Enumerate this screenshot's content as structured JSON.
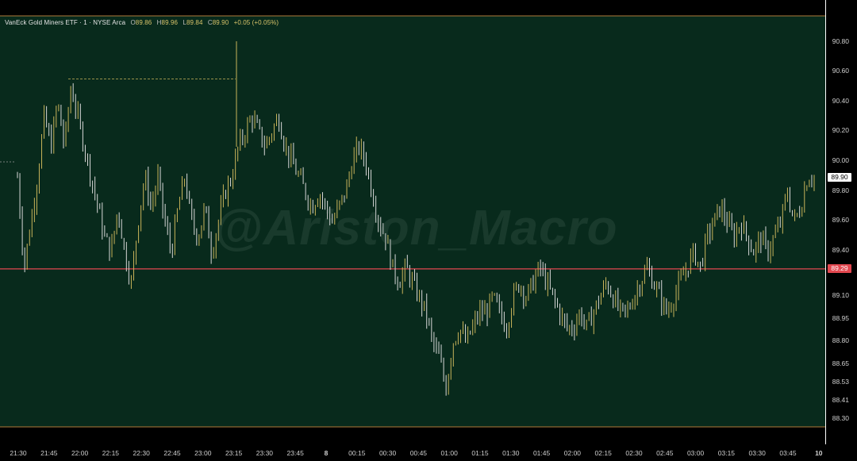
{
  "legend": {
    "symbol": "VanEck Gold Miners ETF · 1 · NYSE Arca",
    "open_label": "O",
    "open": "89.86",
    "high_label": "H",
    "high": "89.96",
    "low_label": "L",
    "low": "89.84",
    "close_label": "C",
    "close": "89.90",
    "change": "+0.05 (+0.05%)"
  },
  "watermark": "@Ariston_Macro",
  "colors": {
    "background": "#082a1c",
    "up_bar": "#c9b45a",
    "down_bar": "#d8d8d8",
    "reference_line": "#e2474f",
    "session_border": "#b07a3a"
  },
  "price_axis": {
    "last_price": "89.90",
    "reference_price": "89.29"
  },
  "chart_data": {
    "type": "ohlc",
    "title": "VanEck Gold Miners ETF · 1 · NYSE Arca",
    "x_ticks": [
      "21:30",
      "21:45",
      "22:00",
      "22:15",
      "22:30",
      "22:45",
      "23:00",
      "23:15",
      "23:30",
      "23:45",
      "8",
      "00:15",
      "00:30",
      "00:45",
      "01:00",
      "01:15",
      "01:30",
      "01:45",
      "02:00",
      "02:15",
      "02:30",
      "02:45",
      "03:00",
      "03:15",
      "03:30",
      "03:45",
      "10"
    ],
    "y_ticks": [
      "90.80",
      "90.60",
      "90.40",
      "90.20",
      "90.00",
      "89.80",
      "89.60",
      "89.40",
      "89.25",
      "89.10",
      "88.95",
      "88.80",
      "88.65",
      "88.53",
      "88.41",
      "88.30"
    ],
    "ylim": [
      88.3,
      90.8
    ],
    "reference_line": 89.29,
    "last_price": 89.9,
    "dashed_level": 90.55,
    "path_time_price": [
      [
        "21:30",
        89.9
      ],
      [
        "21:33",
        89.3
      ],
      [
        "21:36",
        89.6
      ],
      [
        "21:39",
        89.9
      ],
      [
        "21:42",
        90.3
      ],
      [
        "21:45",
        90.1
      ],
      [
        "21:48",
        90.4
      ],
      [
        "21:51",
        90.1
      ],
      [
        "21:54",
        90.5
      ],
      [
        "21:57",
        90.3
      ],
      [
        "22:00",
        90.1
      ],
      [
        "22:03",
        89.9
      ],
      [
        "22:06",
        89.7
      ],
      [
        "22:09",
        89.5
      ],
      [
        "22:12",
        89.4
      ],
      [
        "22:15",
        89.7
      ],
      [
        "22:18",
        89.4
      ],
      [
        "22:21",
        89.2
      ],
      [
        "22:24",
        89.6
      ],
      [
        "22:27",
        89.9
      ],
      [
        "22:30",
        89.7
      ],
      [
        "22:33",
        89.9
      ],
      [
        "22:36",
        89.6
      ],
      [
        "22:39",
        89.4
      ],
      [
        "22:42",
        89.7
      ],
      [
        "22:45",
        89.9
      ],
      [
        "22:48",
        89.6
      ],
      [
        "22:51",
        89.5
      ],
      [
        "22:54",
        89.7
      ],
      [
        "22:57",
        89.4
      ],
      [
        "23:00",
        89.6
      ],
      [
        "23:03",
        89.8
      ],
      [
        "23:06",
        89.9
      ],
      [
        "23:09",
        90.1
      ],
      [
        "23:12",
        90.2
      ],
      [
        "23:15",
        90.3
      ],
      [
        "23:18",
        90.2
      ],
      [
        "23:21",
        90.1
      ],
      [
        "23:24",
        90.2
      ],
      [
        "23:27",
        90.3
      ],
      [
        "23:30",
        90.1
      ],
      [
        "23:33",
        90.0
      ],
      [
        "23:36",
        89.9
      ],
      [
        "23:39",
        89.8
      ],
      [
        "23:42",
        89.7
      ],
      [
        "23:45",
        89.8
      ],
      [
        "23:48",
        89.7
      ],
      [
        "23:51",
        89.6
      ],
      [
        "23:54",
        89.7
      ],
      [
        "23:57",
        89.8
      ],
      [
        "00:00",
        90.0
      ],
      [
        "00:03",
        90.1
      ],
      [
        "00:06",
        90.0
      ],
      [
        "00:09",
        89.8
      ],
      [
        "00:12",
        89.6
      ],
      [
        "00:15",
        89.5
      ],
      [
        "00:18",
        89.3
      ],
      [
        "00:21",
        89.2
      ],
      [
        "00:24",
        89.3
      ],
      [
        "00:27",
        89.2
      ],
      [
        "00:30",
        89.1
      ],
      [
        "00:33",
        89.0
      ],
      [
        "00:36",
        88.8
      ],
      [
        "00:39",
        88.7
      ],
      [
        "00:42",
        88.5
      ],
      [
        "00:45",
        88.8
      ],
      [
        "00:48",
        88.9
      ],
      [
        "00:51",
        88.8
      ],
      [
        "00:54",
        88.9
      ],
      [
        "00:57",
        89.0
      ],
      [
        "01:00",
        89.0
      ],
      [
        "01:03",
        89.1
      ],
      [
        "01:06",
        89.0
      ],
      [
        "01:09",
        88.9
      ],
      [
        "01:12",
        89.1
      ],
      [
        "01:15",
        89.2
      ],
      [
        "01:18",
        89.1
      ],
      [
        "01:21",
        89.2
      ],
      [
        "01:24",
        89.3
      ],
      [
        "01:27",
        89.2
      ],
      [
        "01:30",
        89.1
      ],
      [
        "01:33",
        89.0
      ],
      [
        "01:36",
        88.9
      ],
      [
        "01:39",
        88.9
      ],
      [
        "01:42",
        89.0
      ],
      [
        "01:45",
        88.9
      ],
      [
        "01:48",
        89.0
      ],
      [
        "01:51",
        89.1
      ],
      [
        "01:54",
        89.2
      ],
      [
        "01:57",
        89.1
      ],
      [
        "02:00",
        89.0
      ],
      [
        "02:03",
        89.0
      ],
      [
        "02:06",
        89.1
      ],
      [
        "02:09",
        89.2
      ],
      [
        "02:12",
        89.3
      ],
      [
        "02:15",
        89.2
      ],
      [
        "02:18",
        89.1
      ],
      [
        "02:21",
        89.0
      ],
      [
        "02:24",
        89.1
      ],
      [
        "02:27",
        89.2
      ],
      [
        "02:30",
        89.3
      ],
      [
        "02:33",
        89.4
      ],
      [
        "02:36",
        89.3
      ],
      [
        "02:39",
        89.5
      ],
      [
        "02:42",
        89.6
      ],
      [
        "02:45",
        89.7
      ],
      [
        "02:48",
        89.6
      ],
      [
        "02:51",
        89.5
      ],
      [
        "02:54",
        89.6
      ],
      [
        "02:57",
        89.5
      ],
      [
        "03:00",
        89.4
      ],
      [
        "03:03",
        89.5
      ],
      [
        "03:06",
        89.4
      ],
      [
        "03:09",
        89.5
      ],
      [
        "03:12",
        89.6
      ],
      [
        "03:15",
        89.8
      ],
      [
        "03:18",
        89.6
      ],
      [
        "03:21",
        89.7
      ],
      [
        "03:24",
        89.9
      ],
      [
        "03:27",
        89.9
      ]
    ]
  }
}
